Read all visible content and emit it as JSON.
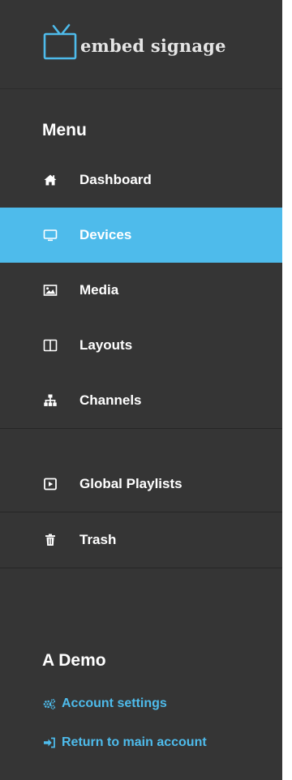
{
  "brand": {
    "name": "embed signage",
    "logo_icon": "tv-icon"
  },
  "menu": {
    "title": "Menu",
    "items": [
      {
        "label": "Dashboard",
        "icon": "home-icon",
        "active": false
      },
      {
        "label": "Devices",
        "icon": "monitor-icon",
        "active": true
      },
      {
        "label": "Media",
        "icon": "image-icon",
        "active": false
      },
      {
        "label": "Layouts",
        "icon": "columns-icon",
        "active": false
      },
      {
        "label": "Channels",
        "icon": "sitemap-icon",
        "active": false
      },
      {
        "label": "Global Playlists",
        "icon": "play-square-icon",
        "active": false
      },
      {
        "label": "Trash",
        "icon": "trash-icon",
        "active": false
      }
    ]
  },
  "account": {
    "name": "A Demo",
    "settings_label": "Account settings",
    "settings_icon": "cogs-icon",
    "return_label": "Return to main account",
    "return_icon": "sign-in-icon"
  },
  "colors": {
    "sidebar_bg": "#353535",
    "active_bg": "#4ebbeb",
    "accent": "#4ebbeb",
    "logo": "#4ebbeb"
  }
}
